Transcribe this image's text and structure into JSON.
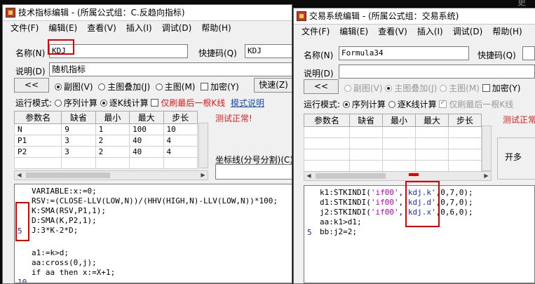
{
  "background_hint": {
    "right_edge_text": "更"
  },
  "left_window": {
    "title": "技术指标编辑 - (所属公式组：C.反趋向指标)",
    "menu": [
      "文件(F)",
      "编辑(E)",
      "查看(V)",
      "插入(I)",
      "调试(D)",
      "帮助(H)"
    ],
    "name_label": "名称(N)",
    "name_value": "KDJ",
    "shortcut_label": "快捷码(Q)",
    "shortcut_value": "KDJ",
    "desc_label": "说明(D)",
    "desc_value": "随机指标",
    "nav_button": "<<",
    "chart_options": [
      "副图(V)",
      "主图叠加(J)",
      "主图(M)"
    ],
    "encrypt_label": "加密(Y)",
    "quick_button": "快速(Z)",
    "run_mode_label": "运行模式:",
    "run_modes": [
      "序列计算",
      "逐K线计算"
    ],
    "last_bar_only": "仅刷最后一根K线",
    "mode_help": "模式说明",
    "test_status": "测试正常!",
    "param_headers": [
      "参数名",
      "缺省",
      "最小",
      "最大",
      "步长"
    ],
    "params": [
      [
        "N",
        "9",
        "1",
        "100",
        "10"
      ],
      [
        "P1",
        "3",
        "2",
        "40",
        "4"
      ],
      [
        "P2",
        "3",
        "2",
        "40",
        "4"
      ]
    ],
    "coord_label": "坐标线(分号分割)(C)",
    "code_lines": [
      "VARIABLE:x:=0;",
      "RSV:=(CLOSE-LLV(LOW,N))/(HHV(HIGH,N)-LLV(LOW,N))*100;",
      "K:SMA(RSV,P1,1);",
      "D:SMA(K,P2,1);",
      "J:3*K-2*D;",
      "",
      "a1:=k>d;",
      "aa:cross(0,j);",
      "if aa then x:=X+1;"
    ],
    "line_number_5": "5",
    "line_number_10": "10"
  },
  "right_window": {
    "title": "交易系统编辑 - (所属公式组：交易系统)",
    "menu": [
      "文件(F)",
      "编辑(E)",
      "查看(V)",
      "插入(I)",
      "调试(D)",
      "帮助(H)"
    ],
    "name_label": "名称(N)",
    "name_value": "Formula34",
    "shortcut_label": "快捷码(Q)",
    "desc_label": "说明(D)",
    "nav_button": "<<",
    "chart_options": [
      "副图(V)",
      "主图叠加(J)",
      "主图(M)"
    ],
    "encrypt_label": "加密(Y)",
    "run_mode_label": "运行模式:",
    "run_modes": [
      "序列计算",
      "逐K线计算"
    ],
    "last_bar_only": "仅刷最后一根K线",
    "test_status": "测试正常",
    "param_headers": [
      "参数名",
      "缺省",
      "最小",
      "最大",
      "步长"
    ],
    "side_label": "开多",
    "code_lines": [
      {
        "pre": "k1:STKINDI(",
        "s1": "'if00'",
        "mid": ",",
        "s2": "'kdj.k'",
        "post": ",0,7,0);"
      },
      {
        "pre": "d1:STKINDI(",
        "s1": "'if00'",
        "mid": ",",
        "s2": "'kdj.d'",
        "post": ",0,7,0);"
      },
      {
        "pre": "j2:STKINDI(",
        "s1": "'if00'",
        "mid": ",",
        "s2": "'kdj.x'",
        "post": ",0,6,0);"
      },
      {
        "pre": "aa:k1>d1;",
        "s1": "",
        "mid": "",
        "s2": "",
        "post": ""
      },
      {
        "pre": "bb:j2=2;",
        "s1": "",
        "mid": "",
        "s2": "",
        "post": ""
      }
    ],
    "line_number_5": "5"
  },
  "colors": {
    "highlight_box": "#e00000",
    "status_red": "#e21a1a",
    "link_blue": "#1a4fb5"
  }
}
